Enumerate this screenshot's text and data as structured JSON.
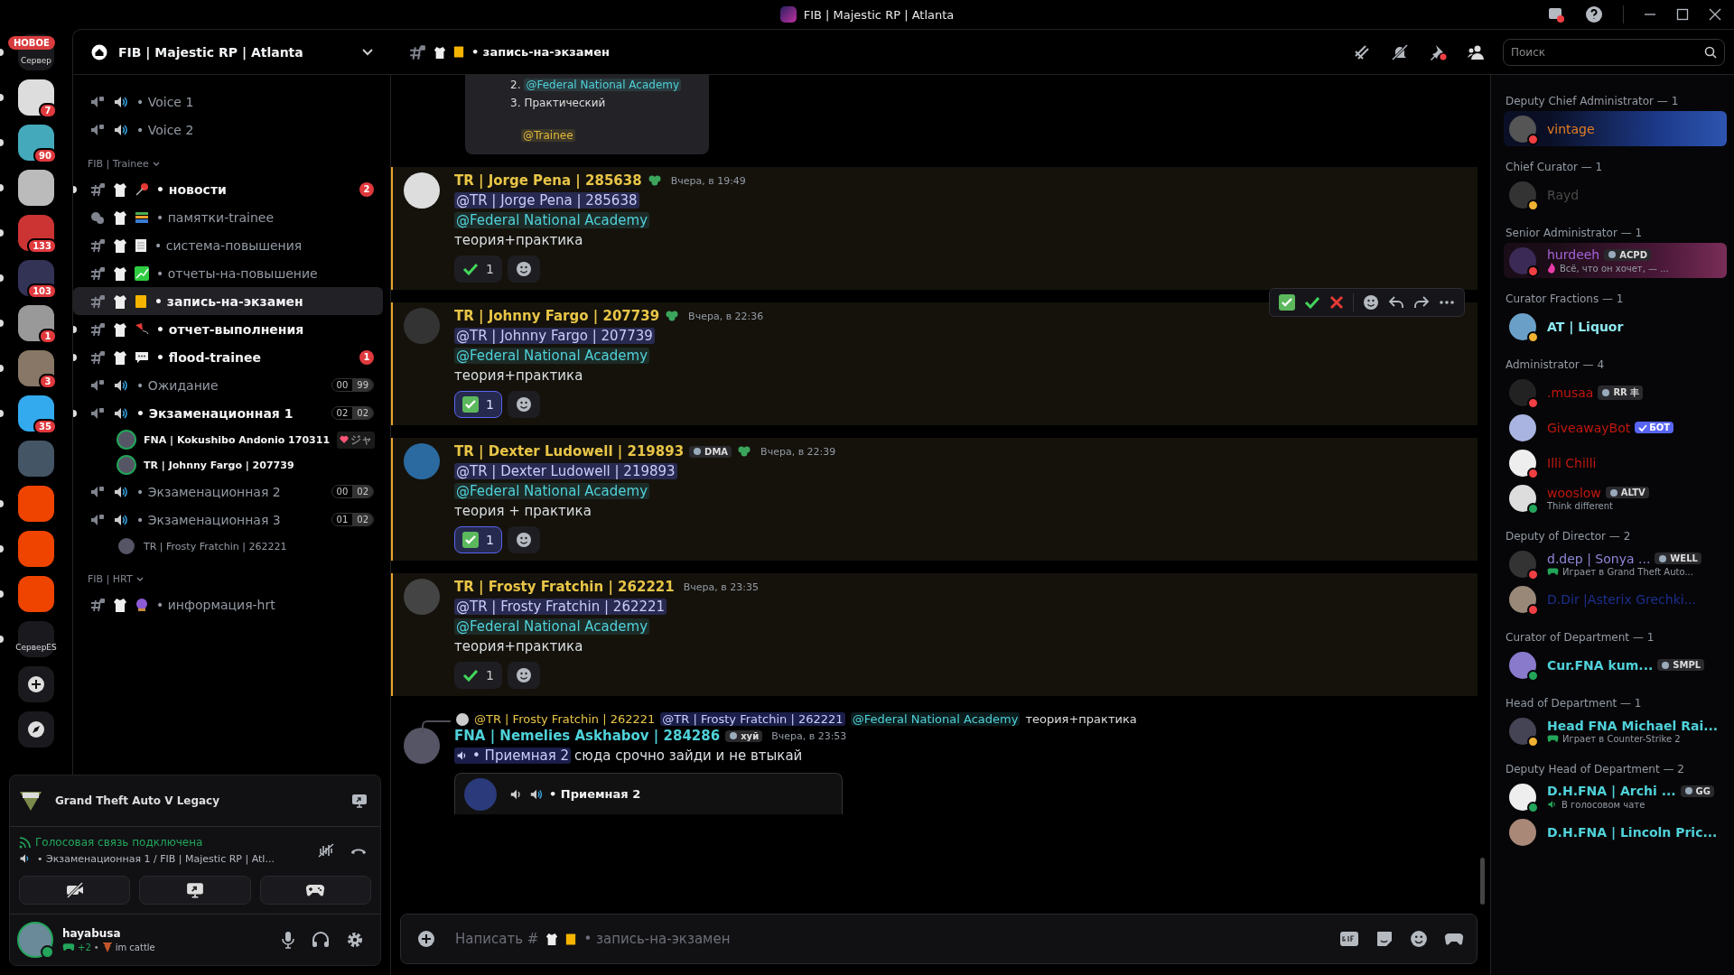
{
  "window": {
    "title": "FIB | Majestic RP | Atlanta"
  },
  "servers": [
    {
      "kind": "text",
      "label": "Сервер",
      "pill": "НОВОЕ",
      "unread": true
    },
    {
      "kind": "image",
      "badge": "7",
      "unread": true
    },
    {
      "kind": "image",
      "badge": "90",
      "unread": true
    },
    {
      "kind": "image",
      "unread": true
    },
    {
      "kind": "image",
      "badge": "133",
      "unread": true
    },
    {
      "kind": "image",
      "badge": "103",
      "unread": true
    },
    {
      "kind": "image",
      "badge": "1",
      "unread": true
    },
    {
      "kind": "image",
      "badge": "3",
      "unread": true
    },
    {
      "kind": "image",
      "badge": "35",
      "unread": true
    },
    {
      "kind": "image",
      "unread": false
    },
    {
      "kind": "image",
      "unread": true
    },
    {
      "kind": "image",
      "unread": true
    },
    {
      "kind": "image",
      "unread": true
    },
    {
      "kind": "text",
      "label": "СерверES",
      "unread": true
    }
  ],
  "sidebar": {
    "server_name": "FIB | Majestic RP | Atlanta",
    "top_channels": [
      {
        "kind": "voice",
        "name": "• Voice 1",
        "selected": false,
        "unread": false
      },
      {
        "kind": "voice",
        "name": "• Voice 2",
        "selected": false,
        "unread": false
      }
    ],
    "categories": [
      {
        "name": "FIB | Trainee",
        "channels": [
          {
            "kind": "text",
            "name": "• новости",
            "unread": true,
            "selected": false,
            "badge": "2"
          },
          {
            "kind": "forum",
            "name": "• памятки-trainee",
            "unread": false,
            "selected": false
          },
          {
            "kind": "text",
            "name": "• система-повышения",
            "unread": false,
            "selected": false
          },
          {
            "kind": "text",
            "name": "• отчеты-на-повышение",
            "unread": false,
            "selected": false
          },
          {
            "kind": "text",
            "name": "• запись-на-экзамен",
            "unread": false,
            "selected": true
          },
          {
            "kind": "text",
            "name": "• отчет-выполнения",
            "unread": true,
            "selected": false
          },
          {
            "kind": "text",
            "name": "• flood-trainee",
            "unread": true,
            "selected": false,
            "badge": "1"
          },
          {
            "kind": "voice",
            "name": "• Ожидание",
            "unread": false,
            "selected": false,
            "users_count": "00",
            "limit": "99"
          },
          {
            "kind": "voice",
            "name": "• Экзаменационная 1",
            "unread": true,
            "selected": false,
            "users_count": "02",
            "limit": "02",
            "users": [
              {
                "name": "FNA | Kokushibo Andonio 170311",
                "tag": "ジャ",
                "speaking": true
              },
              {
                "name": "TR | Johnny Fargo | 207739",
                "speaking": true
              }
            ]
          },
          {
            "kind": "voice",
            "name": "• Экзаменационная 2",
            "unread": false,
            "selected": false,
            "users_count": "00",
            "limit": "02"
          },
          {
            "kind": "voice",
            "name": "• Экзаменационная 3",
            "unread": false,
            "selected": false,
            "users_count": "01",
            "limit": "02",
            "users": [
              {
                "name": "TR | Frosty Fratchin | 262221",
                "speaking": false
              }
            ]
          }
        ]
      },
      {
        "name": "FIB | HRT",
        "channels": [
          {
            "kind": "text",
            "name": "• информация-hrt",
            "unread": false,
            "selected": false
          }
        ]
      }
    ]
  },
  "activity_panel": {
    "game": "Grand Theft Auto V Legacy",
    "voice_status": "Голосовая связь подключена",
    "voice_channel": "• Экзаменационная 1 / FIB | Majestic RP | Atl...",
    "user": {
      "name": "hayabusa",
      "extra": "+2",
      "separator": "•",
      "custom_status": "im cattle",
      "status": {
        "color": "#23a55a"
      }
    }
  },
  "chat_header": {
    "channel": "• запись-на-экзамен",
    "search": {
      "placeholder": "Поиск"
    }
  },
  "embed_top": {
    "items": [
      {
        "number": "2.",
        "mention": "@Federal National Academy",
        "color": "#4fd1d9"
      },
      {
        "number": "3.",
        "text": "Практический"
      }
    ],
    "role_mention": {
      "text": "@Trainee",
      "color": "#e2b93b"
    }
  },
  "messages": [
    {
      "author": "TR | Jorge Pena | 285638",
      "color": "#e8c547",
      "role_icon": true,
      "time": "Вчера, в 19:49",
      "mentioned": true,
      "hovered": false,
      "mentions": [
        {
          "kind": "user",
          "text": "@TR | Jorge Pena | 285638"
        },
        {
          "kind": "role",
          "text": "@Federal National Academy",
          "color": "#4fd1d9"
        }
      ],
      "text": "теория+практика",
      "reactions": [
        {
          "kind": "check-mark",
          "count": "1",
          "selected": false
        }
      ]
    },
    {
      "author": "TR | Johnny Fargo |  207739",
      "color": "#e8c547",
      "role_icon": true,
      "time": "Вчера, в 22:36",
      "mentioned": true,
      "hovered": true,
      "mentions": [
        {
          "kind": "user",
          "text": "@TR | Johnny Fargo |  207739"
        },
        {
          "kind": "role",
          "text": "@Federal National Academy",
          "color": "#4fd1d9"
        }
      ],
      "text": "теория+практика",
      "reactions": [
        {
          "kind": "check-box",
          "count": "1",
          "selected": true
        }
      ]
    },
    {
      "author": "TR | Dexter Ludowell | 219893",
      "color": "#e8c547",
      "tag": "DMA",
      "role_icon": true,
      "time": "Вчера, в 22:39",
      "mentioned": true,
      "hovered": false,
      "mentions": [
        {
          "kind": "user",
          "text": "@TR | Dexter Ludowell | 219893"
        },
        {
          "kind": "role",
          "text": "@Federal National Academy",
          "color": "#4fd1d9"
        }
      ],
      "text": "теория + практика",
      "reactions": [
        {
          "kind": "check-box",
          "count": "1",
          "selected": true
        }
      ]
    },
    {
      "author": "TR | Frosty Fratchin | 262221",
      "color": "#e8c547",
      "role_icon": false,
      "time": "Вчера, в 23:35",
      "mentioned": true,
      "hovered": false,
      "mentions": [
        {
          "kind": "user",
          "text": "@TR | Frosty Fratchin | 262221"
        },
        {
          "kind": "role",
          "text": "@Federal National Academy",
          "color": "#4fd1d9"
        }
      ],
      "text": "теория+практика",
      "reactions": [
        {
          "kind": "check-mark",
          "count": "1",
          "selected": false
        }
      ]
    },
    {
      "author": "FNA | Nemelies Askhabov | 284286",
      "color": "#4fd1d9",
      "tag": "хуй",
      "role_icon": false,
      "time": "Вчера, в 23:53",
      "mentioned": false,
      "hovered": false,
      "reply": {
        "author": "@TR | Frosty Fratchin | 262221",
        "color": "#e8c547",
        "mentions": [
          {
            "kind": "user",
            "text": "@TR | Frosty Fratchin | 262221"
          },
          {
            "kind": "role",
            "text": "@Federal National Academy",
            "color": "#4fd1d9"
          }
        ],
        "text": "теория+практика"
      },
      "channel_mention": "• Приемная 2",
      "text": "сюда срочно зайди и не втыкай",
      "embed": {
        "title": "• Приемная 2"
      }
    }
  ],
  "composer": {
    "placeholder_prefix": "Написать #",
    "placeholder_channel": "• запись-на-экзамен"
  },
  "members": [
    {
      "title": "Deputy Chief Administrator — 1",
      "items": [
        {
          "name": "vintage",
          "color": "#e67e22",
          "status": {
            "color": "#f23f43"
          },
          "banner": true
        }
      ]
    },
    {
      "title": "Chief Curator — 1",
      "items": [
        {
          "name": "Rayd",
          "color": "#4a4a4a",
          "status": {
            "color": "#f0b232"
          }
        }
      ]
    },
    {
      "title": "Senior Administrator — 1",
      "items": [
        {
          "name": "hurdeeh",
          "color": "#a463d6",
          "status": {
            "color": "#f23f43"
          },
          "tag": "ACPD",
          "activity": {
            "kind": "custom",
            "text": "Всё, что он хочет, — ..."
          },
          "banner": true
        }
      ]
    },
    {
      "title": "Curator Fractions — 1",
      "items": [
        {
          "name": "AT | Liquor",
          "color": "#8ee8f0",
          "status": {
            "color": "#f0b232"
          },
          "bold": true
        }
      ]
    },
    {
      "title": "Administrator — 4",
      "items": [
        {
          "name": ".musaa",
          "color": "#c0170f",
          "status": {
            "color": "#f23f43"
          },
          "tag": "RR 丰"
        },
        {
          "name": "GiveawayBot",
          "color": "#c0170f",
          "bot": "БОТ"
        },
        {
          "name": "Illi Chilli",
          "color": "#c0170f",
          "status": {
            "color": "#f23f43"
          }
        },
        {
          "name": "wooslow",
          "color": "#c0170f",
          "status": {
            "color": "#23a55a"
          },
          "tag": "ALTV",
          "activity": {
            "kind": "custom",
            "text": "Think different"
          }
        }
      ]
    },
    {
      "title": "Deputy of Director — 2",
      "items": [
        {
          "name": "d.dep | Sonya ...",
          "color": "#8e86d8",
          "status": {
            "color": "#f23f43"
          },
          "tag": "WELL",
          "activity": {
            "kind": "game",
            "text": "Играет в Grand Theft Auto..."
          }
        },
        {
          "name": "D.Dir |Asterix Grechki...",
          "color": "#1c2f8c",
          "status": {
            "color": "#f23f43"
          }
        }
      ]
    },
    {
      "title": "Curator of Department — 1",
      "items": [
        {
          "name": "Cur.FNA kum...",
          "color": "#4fd1d9",
          "status": {
            "color": "#23a55a"
          },
          "tag": "SMPL",
          "bold": true
        }
      ]
    },
    {
      "title": "Head of Department — 1",
      "items": [
        {
          "name": "Head FNA Michael Rai...",
          "color": "#4fd1d9",
          "status": {
            "color": "#f0b232"
          },
          "bold": true,
          "activity": {
            "kind": "game",
            "text": "Играет в Counter-Strike 2"
          }
        }
      ]
    },
    {
      "title": "Deputy Head of Department — 2",
      "items": [
        {
          "name": "D.H.FNA | Archi ...",
          "color": "#4fd1d9",
          "status": {
            "color": "#23a55a"
          },
          "tag": "GG",
          "bold": true,
          "activity": {
            "kind": "voice",
            "text": "В голосовом чате"
          }
        },
        {
          "name": "D.H.FNA | Lincoln Pric...",
          "color": "#4fd1d9",
          "bold": true
        }
      ]
    }
  ]
}
